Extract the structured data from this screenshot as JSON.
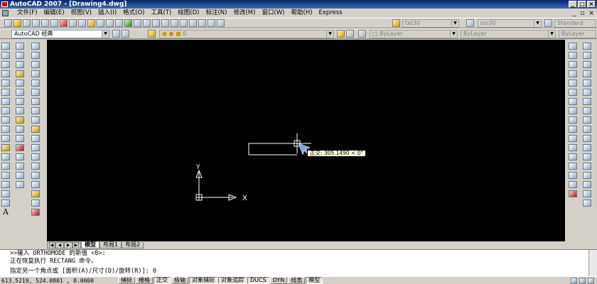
{
  "window": {
    "title": "AutoCAD 2007 - [Drawing4.dwg]",
    "minimize": "_",
    "maximize": "□",
    "close": "×"
  },
  "menu": {
    "items": [
      "文件(F)",
      "编辑(E)",
      "视图(V)",
      "插入(I)",
      "格式(O)",
      "工具(T)",
      "绘图(D)",
      "标注(N)",
      "修改(M)",
      "窗口(W)",
      "帮助(H)",
      "Express"
    ],
    "doc_minimize": "_",
    "doc_restore": "▫",
    "doc_close": "×"
  },
  "toolbar1": {
    "text_style": "txt30",
    "dim_style": "iso30",
    "table_style": "Standard"
  },
  "toolbar2": {
    "workspace": "AutoCAD 经典",
    "layer": "0",
    "color": "ByLayer",
    "linetype": "ByLayer",
    "lineweight": "ByLayer"
  },
  "canvas": {
    "tooltip": "正交: 305.1490 < 0°",
    "ucs_y_label": "Y",
    "ucs_x_label": "X",
    "colors": {
      "background": "#000000",
      "geometry": "#ffffff",
      "tooltip_bg": "#ffffe1"
    }
  },
  "layout_tabs": {
    "nav": [
      "|◀",
      "◀",
      "▶",
      "▶|"
    ],
    "items": [
      "模型",
      "布局1",
      "布局2"
    ],
    "active": "模型"
  },
  "command": {
    "line1": ">>输入 ORTHOMODE 的新值 <0>:",
    "line2": "正在恢复执行 RECTANG 命令。",
    "prompt": "指定另一个角点或 [面积(A)/尺寸(D)/旋转(R)]: 0"
  },
  "status": {
    "coords": "613.5219, 524.0801 , 0.0000",
    "toggles": [
      {
        "label": "捕捉",
        "on": false
      },
      {
        "label": "栅格",
        "on": false
      },
      {
        "label": "正交",
        "on": true
      },
      {
        "label": "极轴",
        "on": false
      },
      {
        "label": "对象捕捉",
        "on": true
      },
      {
        "label": "对象追踪",
        "on": true
      },
      {
        "label": "DUCS",
        "on": true
      },
      {
        "label": "DYN",
        "on": false
      },
      {
        "label": "线宽",
        "on": false
      },
      {
        "label": "模型",
        "on": true
      }
    ]
  }
}
